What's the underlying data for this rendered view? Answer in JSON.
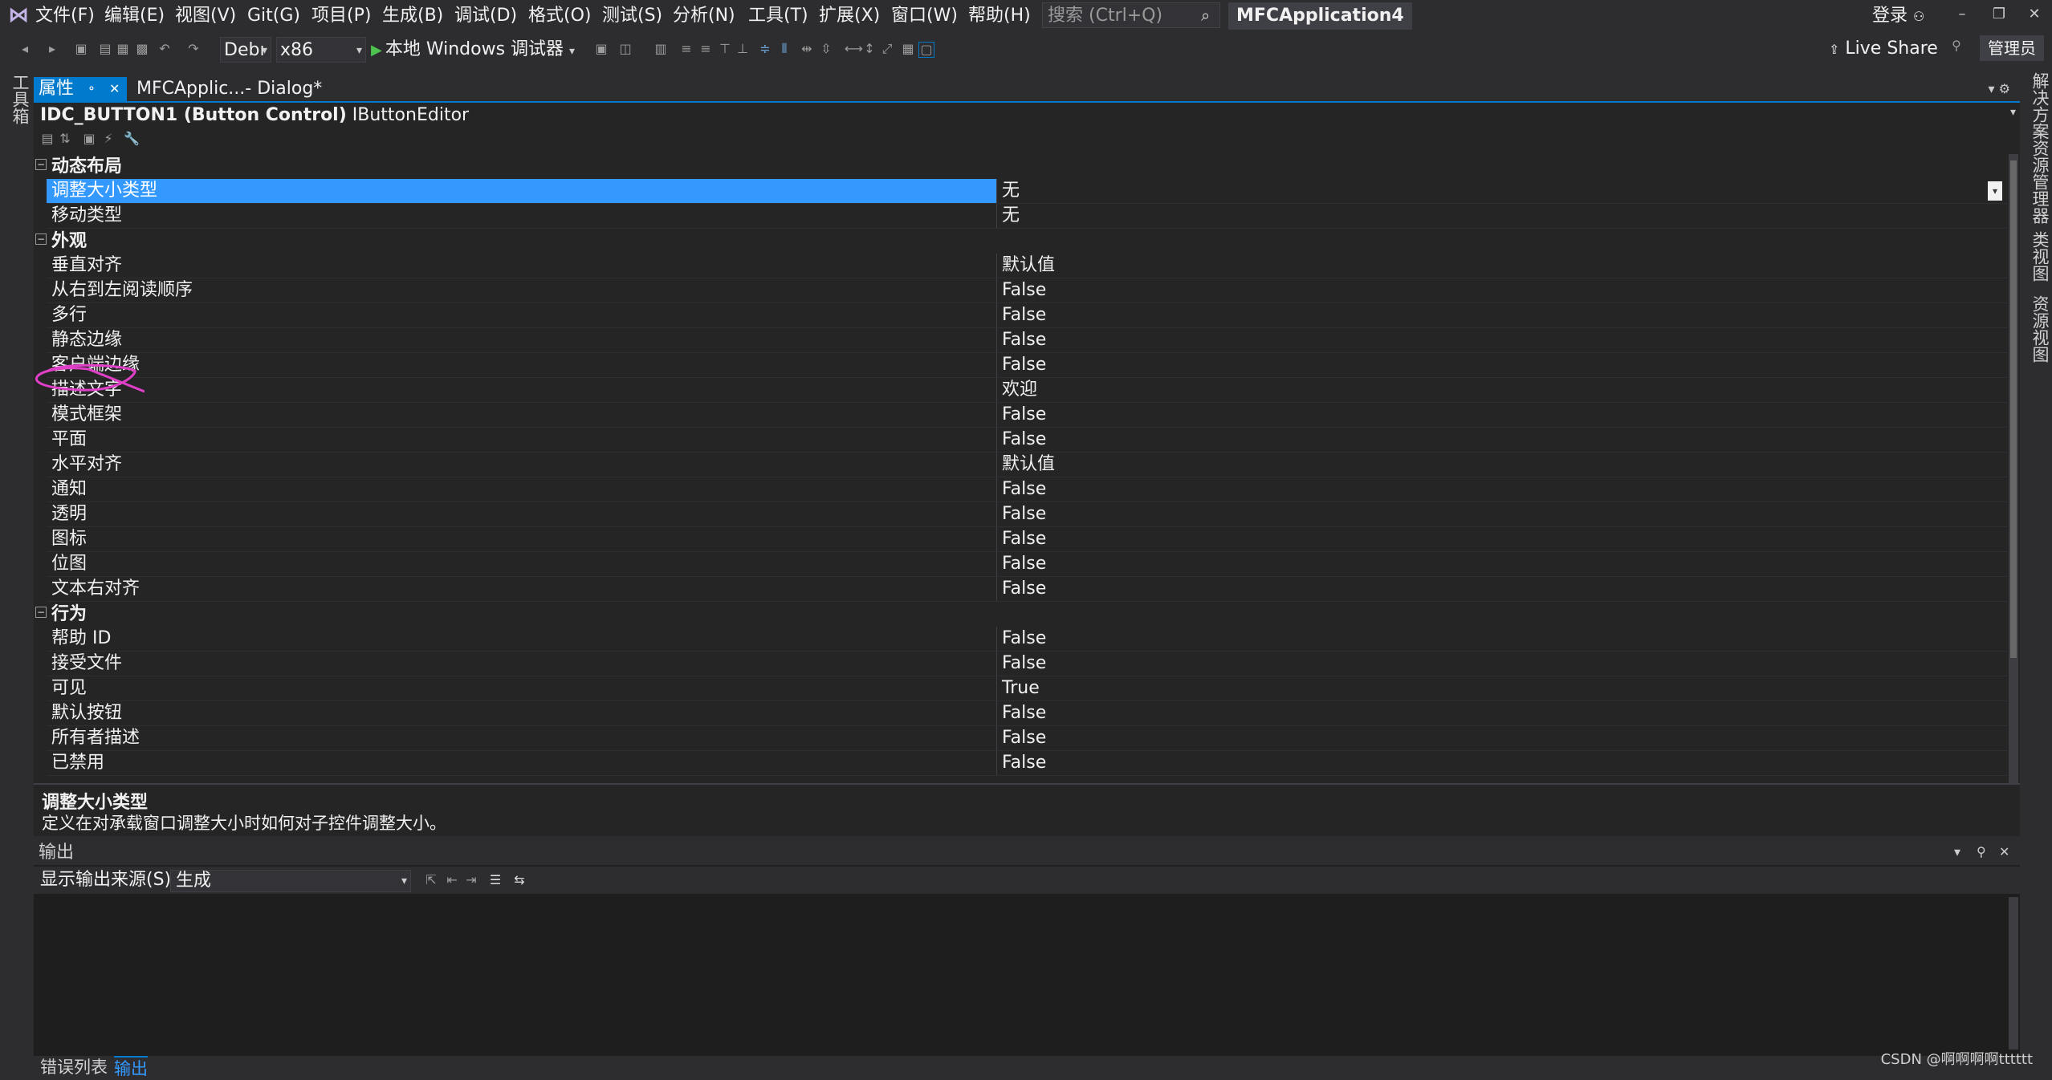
{
  "menu": {
    "items": [
      "文件(F)",
      "编辑(E)",
      "视图(V)",
      "Git(G)",
      "项目(P)",
      "生成(B)",
      "调试(D)",
      "格式(O)",
      "测试(S)",
      "分析(N)",
      "工具(T)",
      "扩展(X)",
      "窗口(W)",
      "帮助(H)"
    ],
    "search_placeholder": "搜索 (Ctrl+Q)",
    "solution_name": "MFCApplication4",
    "login": "登录"
  },
  "toolbar": {
    "config": "Debı",
    "platform": "x86",
    "run_label": "本地 Windows 调试器",
    "live_share": "Live Share",
    "admin": "管理员"
  },
  "left_strip": {
    "toolbox": "工具箱"
  },
  "right_strip": {
    "tabs": [
      "解决方案资源管理器",
      "类视图",
      "资源视图"
    ]
  },
  "tabs": {
    "properties": "属性",
    "dialog": "MFCApplic...- Dialog*"
  },
  "properties": {
    "object_id": "IDC_BUTTON1 (Button Control)",
    "object_editor": "IButtonEditor",
    "categories": [
      {
        "label": "动态布局",
        "rows": [
          {
            "name": "调整大小类型",
            "value": "无",
            "selected": true
          },
          {
            "name": "移动类型",
            "value": "无"
          }
        ]
      },
      {
        "label": "外观",
        "rows": [
          {
            "name": "垂直对齐",
            "value": "默认值"
          },
          {
            "name": "从右到左阅读顺序",
            "value": "False"
          },
          {
            "name": "多行",
            "value": "False"
          },
          {
            "name": "静态边缘",
            "value": "False"
          },
          {
            "name": "客户端边缘",
            "value": "False"
          },
          {
            "name": "描述文字",
            "value": "欢迎"
          },
          {
            "name": "模式框架",
            "value": "False"
          },
          {
            "name": "平面",
            "value": "False"
          },
          {
            "name": "水平对齐",
            "value": "默认值"
          },
          {
            "name": "通知",
            "value": "False"
          },
          {
            "name": "透明",
            "value": "False"
          },
          {
            "name": "图标",
            "value": "False"
          },
          {
            "name": "位图",
            "value": "False"
          },
          {
            "name": "文本右对齐",
            "value": "False"
          }
        ]
      },
      {
        "label": "行为",
        "rows": [
          {
            "name": "帮助 ID",
            "value": "False"
          },
          {
            "name": "接受文件",
            "value": "False"
          },
          {
            "name": "可见",
            "value": "True"
          },
          {
            "name": "默认按钮",
            "value": "False"
          },
          {
            "name": "所有者描述",
            "value": "False"
          },
          {
            "name": "已禁用",
            "value": "False"
          }
        ]
      }
    ]
  },
  "description": {
    "title": "调整大小类型",
    "text": "定义在对承载窗口调整大小时如何对子控件调整大小。"
  },
  "output": {
    "title": "输出",
    "source_label": "显示输出来源(S):",
    "source_value": "生成"
  },
  "bottom_tabs": [
    "错误列表",
    "输出"
  ],
  "watermark": "CSDN @啊啊啊啊tttttt",
  "colors": {
    "accent": "#007acc",
    "selection": "#3399ff",
    "annotation": "#e040c8"
  }
}
